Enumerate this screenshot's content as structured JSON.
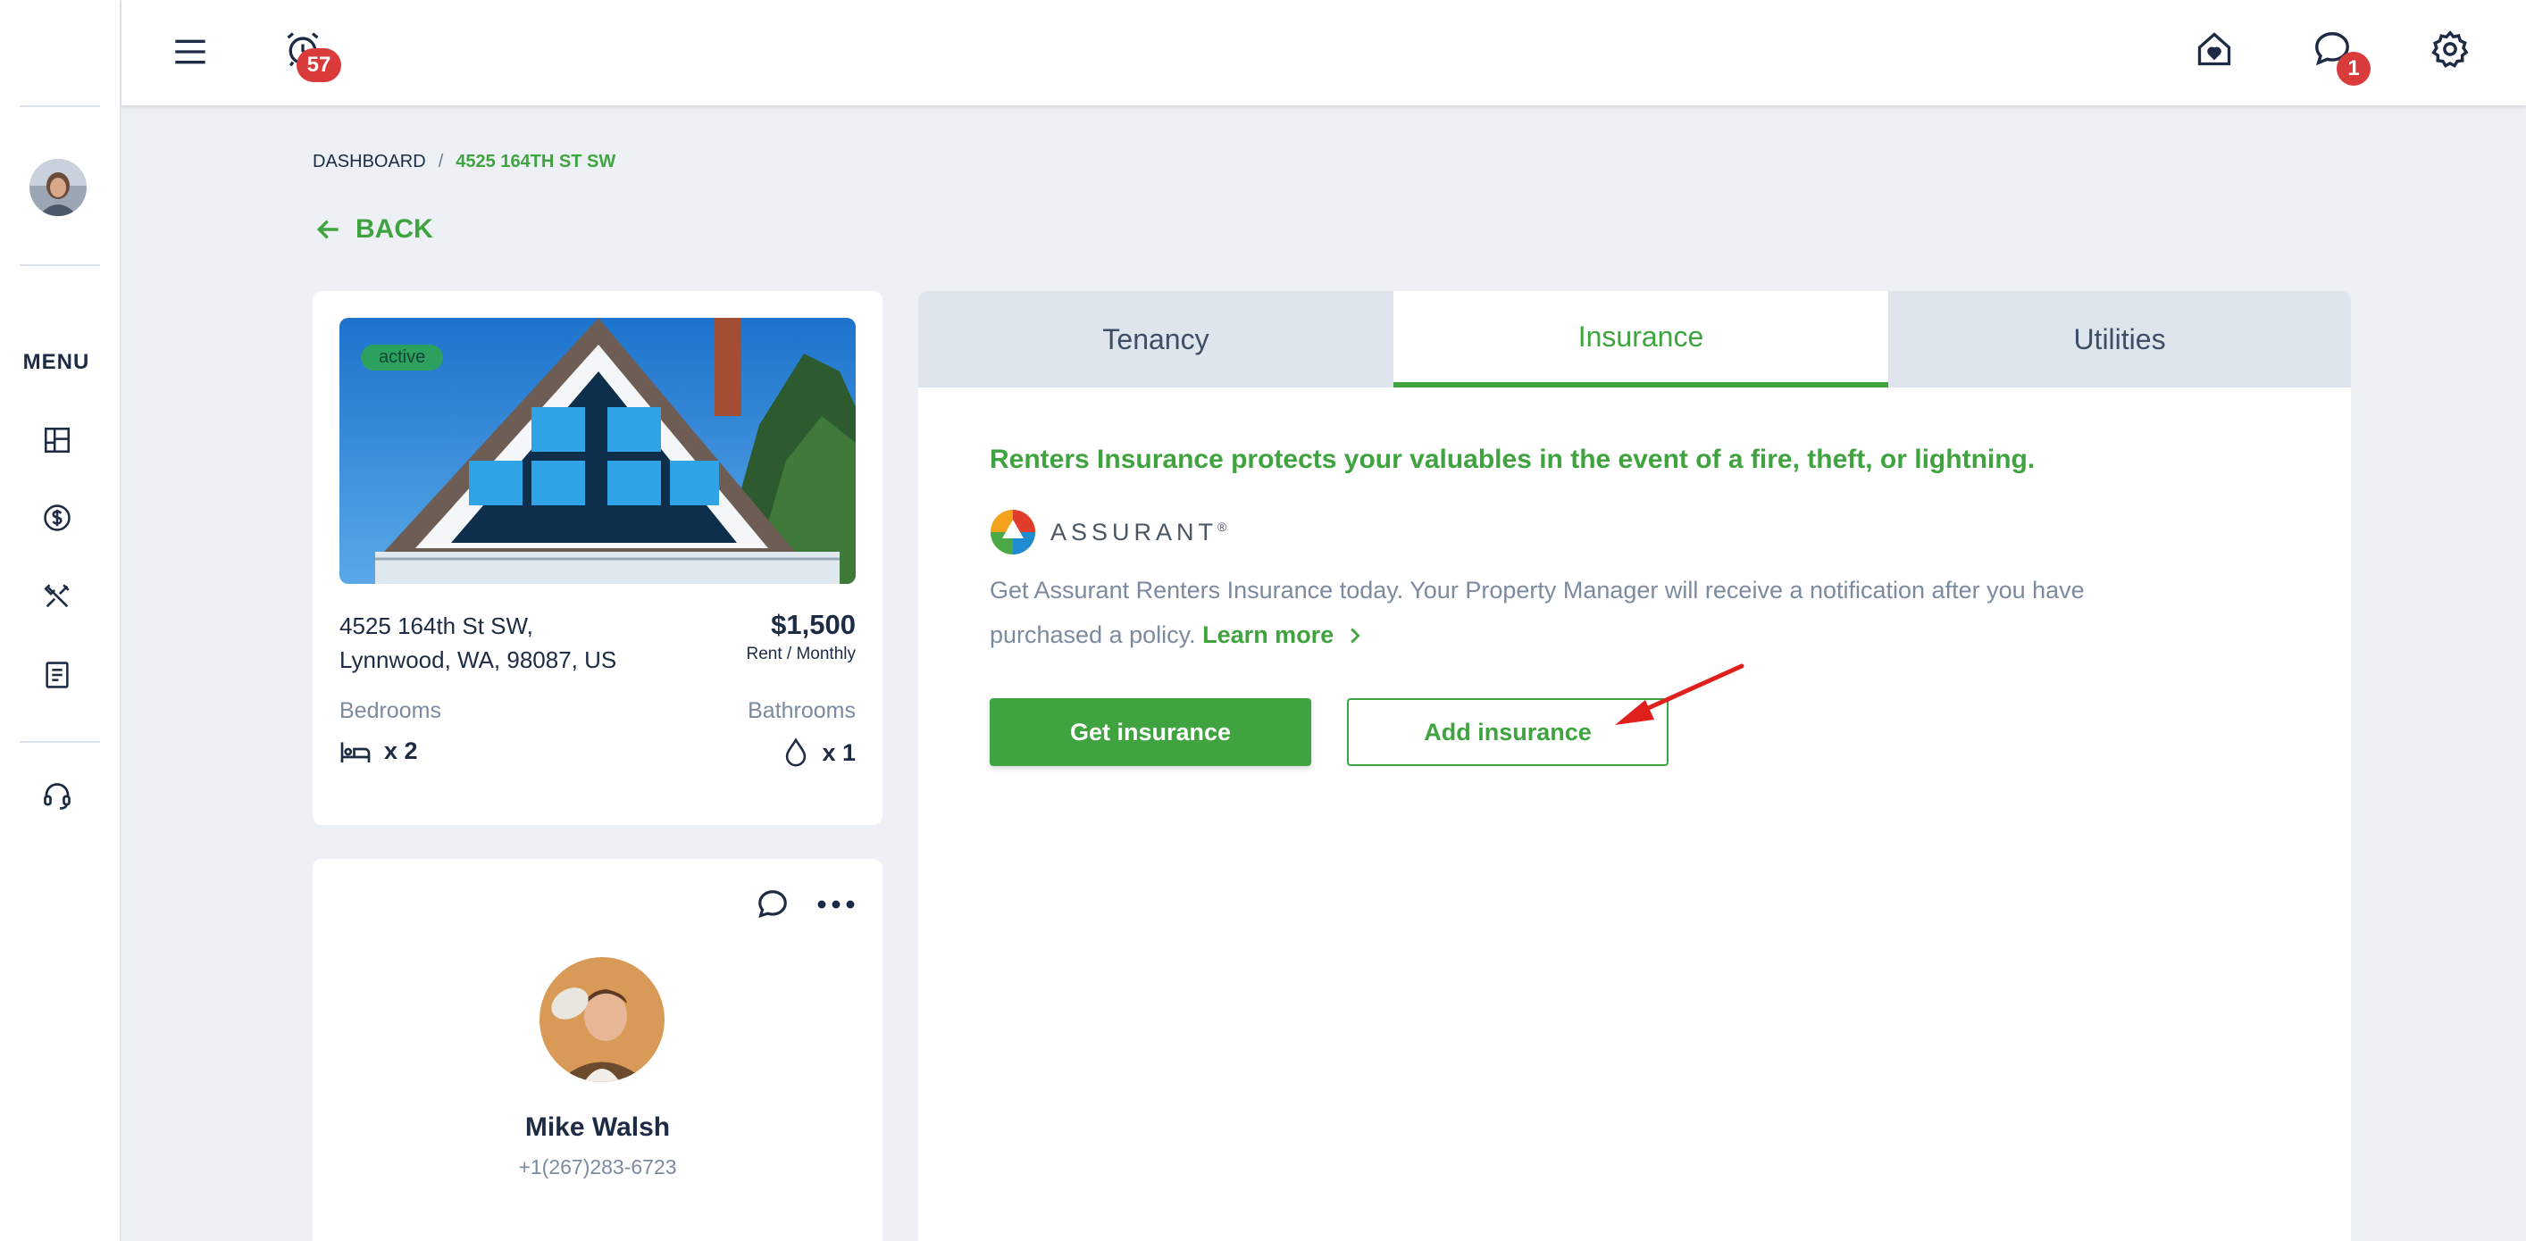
{
  "colors": {
    "accent": "#3fa33f",
    "badge": "#d93b3b",
    "text": "#1d2b45",
    "muted": "#7c8aa0",
    "annotation": "#e0201c"
  },
  "sidebar": {
    "menu_label": "MENU",
    "items": [
      {
        "icon": "dashboard-icon"
      },
      {
        "icon": "dollar-icon"
      },
      {
        "icon": "tools-icon"
      },
      {
        "icon": "document-icon"
      },
      {
        "icon": "headset-icon"
      }
    ]
  },
  "topbar": {
    "alarm_badge": "57",
    "messages_badge": "1",
    "icons": [
      "hamburger-menu-icon",
      "alarm-clock-icon",
      "home-heart-icon",
      "chat-bubble-icon",
      "gear-icon"
    ]
  },
  "breadcrumb": {
    "root": "DASHBOARD",
    "separator": "/",
    "current": "4525 164TH ST SW"
  },
  "back_label": "BACK",
  "property": {
    "status": "active",
    "address_line1": "4525 164th St SW,",
    "address_line2": "Lynnwood, WA, 98087, US",
    "price": "$1,500",
    "price_period": "Rent / Monthly",
    "bedrooms_label": "Bedrooms",
    "bedrooms_value": "x 2",
    "bathrooms_label": "Bathrooms",
    "bathrooms_value": "x 1"
  },
  "contact": {
    "name": "Mike Walsh",
    "phone": "+1(267)283-6723"
  },
  "tabs": [
    {
      "label": "Tenancy",
      "active": false
    },
    {
      "label": "Insurance",
      "active": true
    },
    {
      "label": "Utilities",
      "active": false
    }
  ],
  "insurance": {
    "headline": "Renters Insurance protects your valuables in the event of a fire, theft, or lightning.",
    "provider_logo_text": "ASSURANT",
    "provider_mark": "®",
    "description": "Get Assurant Renters Insurance today. Your Property Manager will receive a notification after you have purchased a policy.",
    "learn_more": "Learn more",
    "get_button": "Get insurance",
    "add_button": "Add insurance"
  }
}
